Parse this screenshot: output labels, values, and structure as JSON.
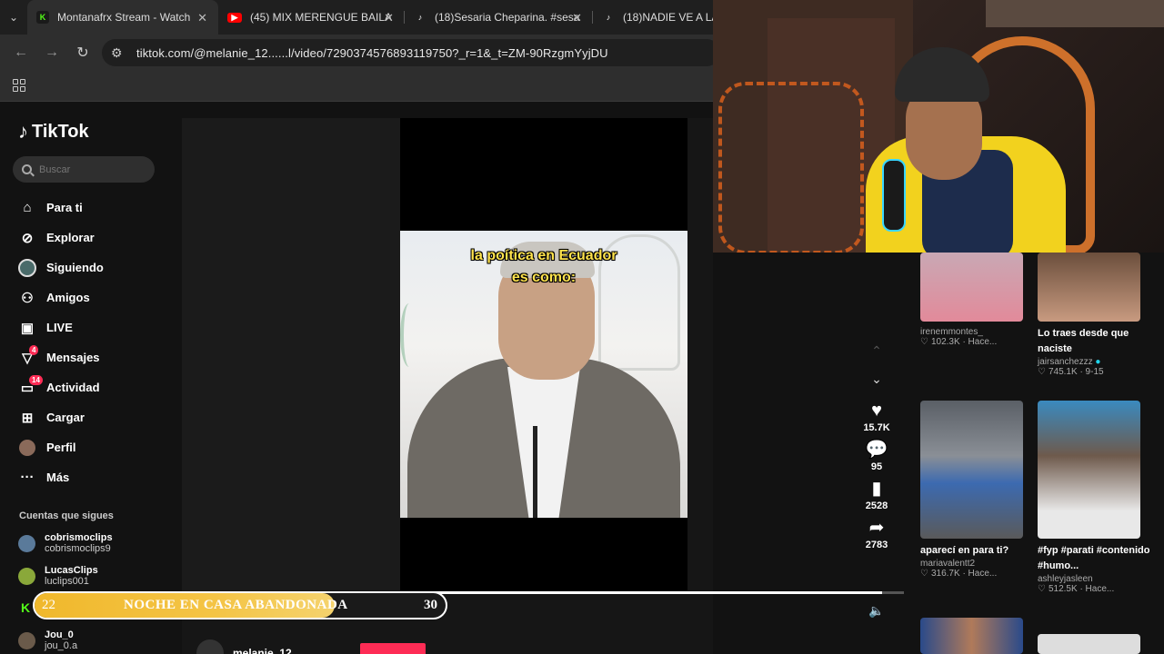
{
  "browser": {
    "tabs": [
      {
        "title": "Montanafrx Stream - Watch",
        "icon": "kick-icon",
        "color": "#53fc18"
      },
      {
        "title": "(45) MIX MERENGUE BAILA",
        "icon": "youtube-icon",
        "color": "#ff0000"
      },
      {
        "title": "(18)Sesaria Cheparina. #sesa",
        "icon": "tiktok-icon",
        "color": "#000000"
      },
      {
        "title": "(18)NADIE VE A LA",
        "icon": "tiktok-icon",
        "color": "#000000"
      }
    ],
    "url": "tiktok.com/@melanie_12......l/video/7290374576893119750?_r=1&_t=ZM-90RzgmYyjDU"
  },
  "tiktok": {
    "logo": "TikTok",
    "search_placeholder": "Buscar",
    "nav": [
      {
        "label": "Para ti",
        "icon": "home-icon"
      },
      {
        "label": "Explorar",
        "icon": "compass-icon"
      },
      {
        "label": "Siguiendo",
        "icon": "following-avatar-icon"
      },
      {
        "label": "Amigos",
        "icon": "friends-icon"
      },
      {
        "label": "LIVE",
        "icon": "live-icon"
      },
      {
        "label": "Mensajes",
        "icon": "messages-icon",
        "badge": "4"
      },
      {
        "label": "Actividad",
        "icon": "activity-icon",
        "badge": "14"
      },
      {
        "label": "Cargar",
        "icon": "upload-icon"
      },
      {
        "label": "Perfil",
        "icon": "profile-avatar-icon"
      },
      {
        "label": "Más",
        "icon": "more-icon"
      }
    ],
    "following_title": "Cuentas que sigues",
    "following": [
      {
        "name": "cobrismoclips",
        "handle": "cobrismoclips9"
      },
      {
        "name": "LucasClips",
        "handle": "luclips001"
      },
      {
        "name": "Jou_0",
        "handle": "jou_0.a"
      }
    ],
    "video": {
      "caption_line1": "la poítica  en Ecuador",
      "caption_line2": "es como:",
      "likes": "15.7K",
      "comments": "95",
      "saves": "2528",
      "shares": "2783",
      "progress": 0.97,
      "author": "melanie_12"
    },
    "recommended": [
      {
        "title": "",
        "user": "irenemmontes_",
        "stats": "102.3K · Hace..."
      },
      {
        "title": "Lo traes desde que naciste",
        "user": "jairsanchezzz",
        "verified": true,
        "stats": "745.1K · 9-15"
      },
      {
        "title": "aparecí en para ti?",
        "user": "mariavalentt2",
        "stats": "316.7K · Hace..."
      },
      {
        "title": "#fyp #parati #contenido #humo...",
        "user": "ashleyjasleen",
        "stats": "512.5K · Hace..."
      }
    ]
  },
  "overlay": {
    "left_number": "22",
    "label": "NOCHE EN CASA ABANDONADA",
    "right_number": "30",
    "accent": "#f0b82c"
  }
}
